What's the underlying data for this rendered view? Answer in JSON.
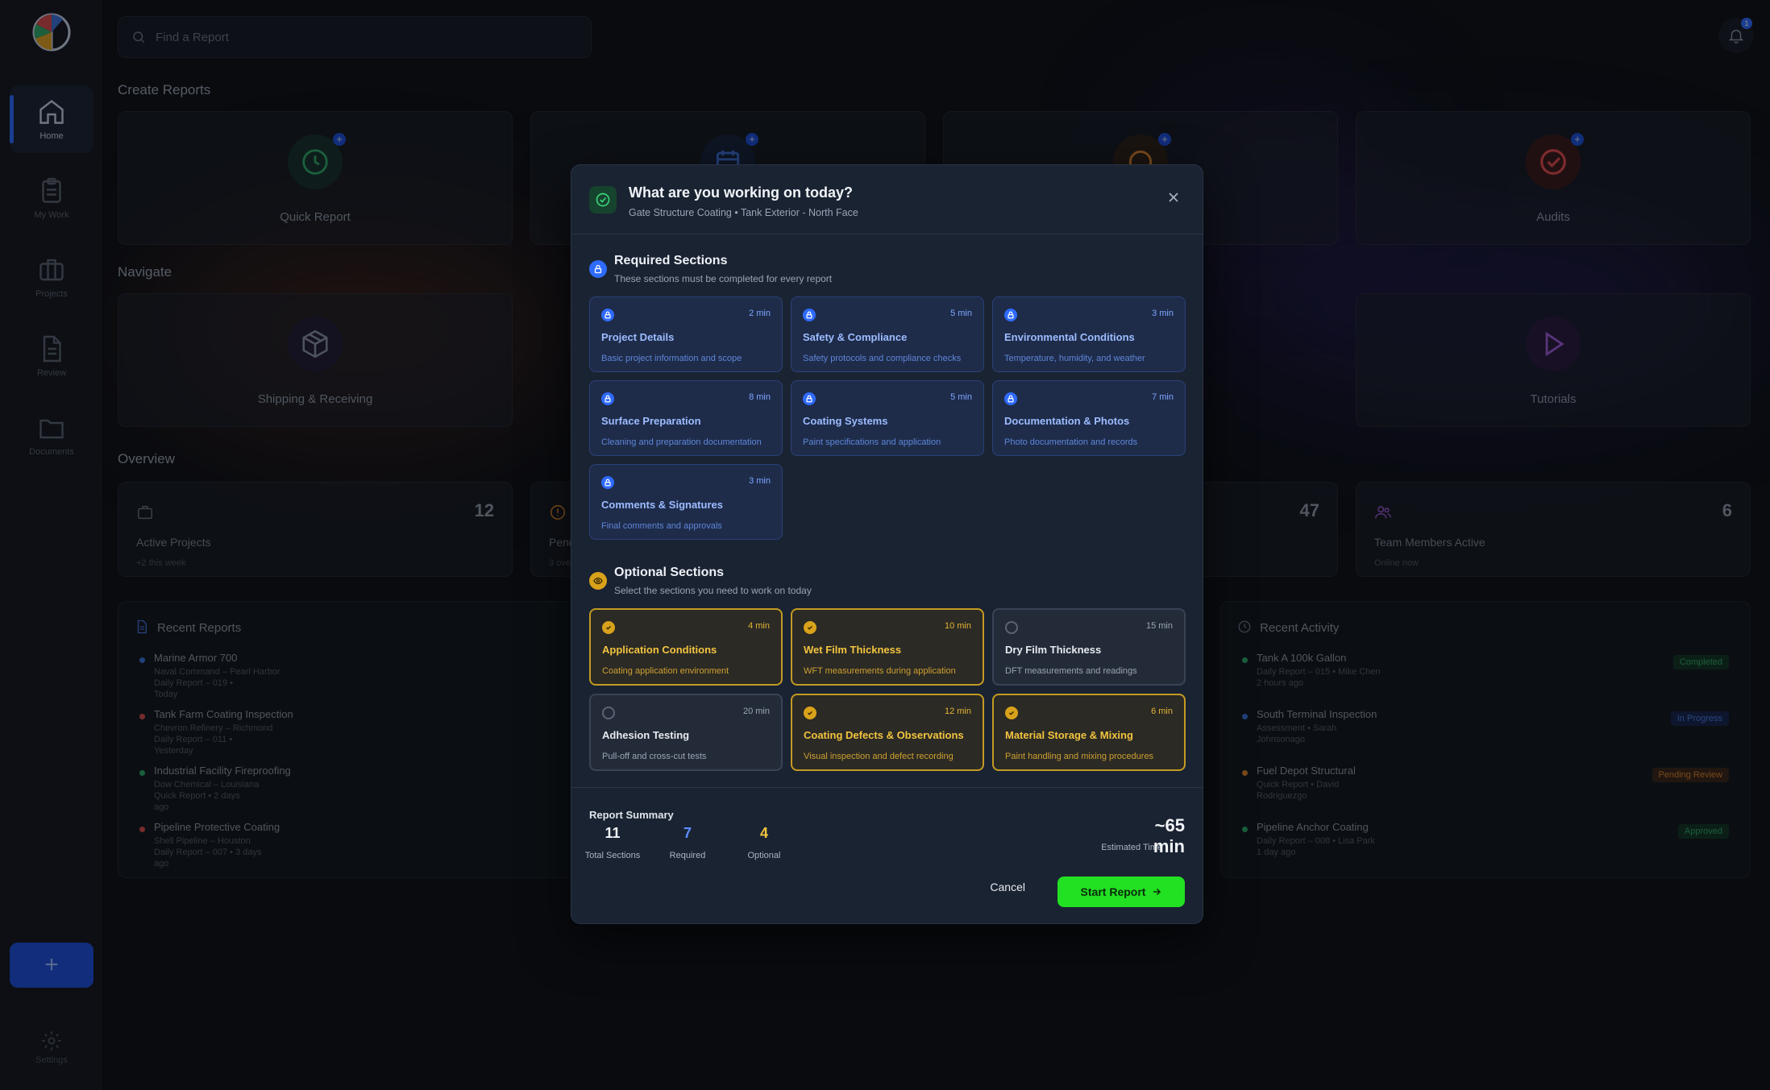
{
  "nav": {
    "items": [
      {
        "label": "Home"
      },
      {
        "label": "My Work"
      },
      {
        "label": "Projects"
      },
      {
        "label": "Review"
      },
      {
        "label": "Documents"
      }
    ],
    "fab_label": "+",
    "settings_label": "Settings"
  },
  "search": {
    "placeholder": "Find a Report"
  },
  "notifications": {
    "count": "1"
  },
  "create": {
    "title": "Create Reports",
    "cards": [
      {
        "label": "Quick Report",
        "icon": "clock-icon"
      },
      {
        "label": "",
        "icon": "calendar-icon"
      },
      {
        "label": "",
        "icon": "circle-icon"
      },
      {
        "label": "Audits",
        "icon": "check-circle-icon"
      }
    ]
  },
  "navigate": {
    "title": "Navigate",
    "cards": [
      {
        "label": "Shipping & Receiving",
        "icon": "package-icon"
      },
      {
        "label": "Tutorials",
        "icon": "play-icon"
      }
    ]
  },
  "overview": {
    "title": "Overview",
    "stats": [
      {
        "label": "Active Projects",
        "value": "12",
        "sub": "+2 this week"
      },
      {
        "label": "Pend",
        "value": "",
        "sub": "3 ove"
      },
      {
        "label": "",
        "value": "47",
        "sub": ""
      },
      {
        "label": "Team Members Active",
        "value": "6",
        "sub": "Online now"
      }
    ]
  },
  "recent_reports": {
    "title": "Recent Reports",
    "items": [
      {
        "title": "Marine Armor 700",
        "line1": "Naval Command – Pearl Harbor",
        "line2": "Daily Report – 019 •",
        "line3": "Today",
        "color": "#3b6fd8"
      },
      {
        "title": "Tank Farm Coating Inspection",
        "line1": "Chevron Refinery – Richmond",
        "line2": "Daily Report – 011 •",
        "line3": "Yesterday",
        "color": "#d84a4a"
      },
      {
        "title": "Industrial Facility Fireproofing",
        "line1": "Dow Chemical – Louisiana",
        "line2": "Quick Report • 2 days",
        "line3": "ago",
        "color": "#2fa864"
      },
      {
        "title": "Pipeline Protective Coating",
        "line1": "Shell Pipeline – Houston",
        "line2": "Daily Report – 007 • 3 days",
        "line3": "ago",
        "color": "#d84a4a"
      }
    ]
  },
  "recent_activity": {
    "title": "Recent Activity",
    "items": [
      {
        "title": "Tank A 100k Gallon",
        "line1": "Daily Report – 015 • Mike Chen",
        "line2": "2 hours ago",
        "status": "Completed",
        "color": "#2fa864",
        "status_bg": "#123322",
        "status_fg": "#2fa864"
      },
      {
        "title": "South Terminal Inspection",
        "line1": "Assessment • Sarah",
        "line2": "Johnsonago",
        "status": "In Progress",
        "color": "#3b6fd8",
        "status_bg": "#14244a",
        "status_fg": "#4b7be0"
      },
      {
        "title": "Fuel Depot Structural",
        "line1": "Quick Report • David",
        "line2": "Rodriguezgo",
        "status": "Pending Review",
        "color": "#d9822b",
        "status_bg": "#3a2414",
        "status_fg": "#d9822b"
      },
      {
        "title": "Pipeline Anchor Coating",
        "line1": "Daily Report – 008 • Lisa Park",
        "line2": "1 day ago",
        "status": "Approved",
        "color": "#2fa864",
        "status_bg": "#123322",
        "status_fg": "#2fa864"
      }
    ]
  },
  "modal": {
    "title": "What are you working on today?",
    "subtitle": "Gate Structure Coating • Tank Exterior - North Face",
    "required": {
      "title": "Required Sections",
      "subtitle": "These sections must be completed for every report",
      "items": [
        {
          "name": "Project Details",
          "time": "2 min",
          "desc": "Basic project information and scope"
        },
        {
          "name": "Safety & Compliance",
          "time": "5 min",
          "desc": "Safety protocols and compliance checks"
        },
        {
          "name": "Environmental Conditions",
          "time": "3 min",
          "desc": "Temperature, humidity, and weather"
        },
        {
          "name": "Surface Preparation",
          "time": "8 min",
          "desc": "Cleaning and preparation documentation"
        },
        {
          "name": "Coating Systems",
          "time": "5 min",
          "desc": "Paint specifications and application"
        },
        {
          "name": "Documentation & Photos",
          "time": "7 min",
          "desc": "Photo documentation and records"
        },
        {
          "name": "Comments & Signatures",
          "time": "3 min",
          "desc": "Final comments and approvals"
        }
      ]
    },
    "optional": {
      "title": "Optional Sections",
      "subtitle": "Select the sections you need to work on today",
      "items": [
        {
          "name": "Application Conditions",
          "time": "4 min",
          "desc": "Coating application environment",
          "selected": true
        },
        {
          "name": "Wet Film Thickness",
          "time": "10 min",
          "desc": "WFT measurements during application",
          "selected": true
        },
        {
          "name": "Dry Film Thickness",
          "time": "15 min",
          "desc": "DFT measurements and readings",
          "selected": false
        },
        {
          "name": "Adhesion Testing",
          "time": "20 min",
          "desc": "Pull-off and cross-cut tests",
          "selected": false
        },
        {
          "name": "Coating Defects & Observations",
          "time": "12 min",
          "desc": "Visual inspection and defect recording",
          "selected": true
        },
        {
          "name": "Material Storage & Mixing",
          "time": "6 min",
          "desc": "Paint handling and mixing procedures",
          "selected": true
        }
      ]
    },
    "summary": {
      "label": "Report Summary",
      "total": "11",
      "total_label": "Total Sections",
      "required": "7",
      "required_label": "Required",
      "optional": "4",
      "optional_label": "Optional",
      "estimate": "~65",
      "estimate_unit": "min",
      "estimate_label": "Estimated Time"
    },
    "cancel_label": "Cancel",
    "start_label": "Start Report"
  }
}
